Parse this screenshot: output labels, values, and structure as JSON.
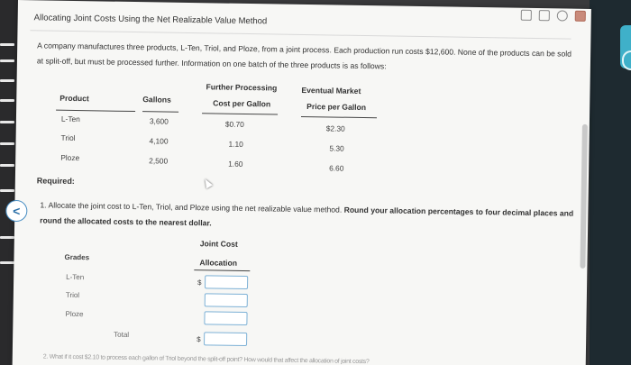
{
  "title": "Allocating Joint Costs Using the Net Realizable Value Method",
  "intro": "A company manufactures three products, L-Ten, Triol, and Ploze, from a joint process. Each production run costs $12,600. None of the products can be sold at split-off, but must be processed further. Information on one batch of the three products is as follows:",
  "table1": {
    "headers": {
      "product": "Product",
      "gallons": "Gallons",
      "fp_line1": "Further Processing",
      "fp_line2": "Cost per Gallon",
      "em_line1": "Eventual Market",
      "em_line2": "Price per Gallon"
    },
    "rows": [
      {
        "product": "L-Ten",
        "gallons": "3,600",
        "fp_cost": "$0.70",
        "price": "$2.30"
      },
      {
        "product": "Triol",
        "gallons": "4,100",
        "fp_cost": "1.10",
        "price": "5.30"
      },
      {
        "product": "Ploze",
        "gallons": "2,500",
        "fp_cost": "1.60",
        "price": "6.60"
      }
    ]
  },
  "required_label": "Required:",
  "question1": {
    "text": "1. Allocate the joint cost to L-Ten, Triol, and Ploze using the net realizable value method. ",
    "bold": "Round your allocation percentages to four decimal places and round the allocated costs to the nearest dollar."
  },
  "table2": {
    "header_line1": "Joint Cost",
    "header_line2": "Allocation",
    "grades_label": "Grades",
    "rows": [
      {
        "label": "L-Ten",
        "value": "",
        "currency": "$"
      },
      {
        "label": "Triol",
        "value": "",
        "currency": ""
      },
      {
        "label": "Ploze",
        "value": "",
        "currency": ""
      }
    ],
    "total_label": "Total",
    "total_currency": "$",
    "total_value": ""
  },
  "back_button": "<",
  "next_question_partial": "2. What if it cost $2.10 to process each gallon of Triol beyond the split-off point? How would that affect the allocation of joint costs?",
  "colors": {
    "input_border": "#7db1d6",
    "accent_tab": "#3fb0c9",
    "page_bg": "#f7f7f5"
  }
}
